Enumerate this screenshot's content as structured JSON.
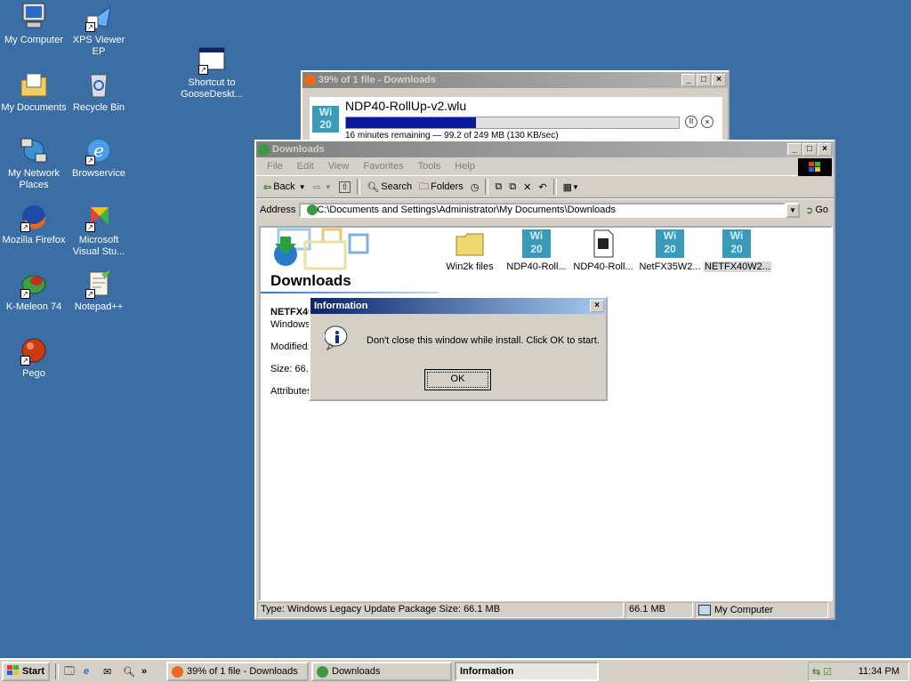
{
  "desktop": {
    "icons": [
      {
        "label": "My Computer"
      },
      {
        "label": "XPS Viewer EP"
      },
      {
        "label": "My Documents"
      },
      {
        "label": "Recycle Bin"
      },
      {
        "label": "My Network Places"
      },
      {
        "label": "Browservice"
      },
      {
        "label": "Mozilla Firefox"
      },
      {
        "label": "Microsoft Visual Stu..."
      },
      {
        "label": "K-Meleon 74"
      },
      {
        "label": "Notepad++"
      },
      {
        "label": "Pego"
      },
      {
        "label": "Shortcut to GooseDeskt..."
      }
    ]
  },
  "download_window": {
    "title": "39% of 1 file - Downloads",
    "filename": "NDP40-RollUp-v2.wlu",
    "progress": 0.39,
    "status": "16 minutes remaining — 99.2 of 249 MB (130 KB/sec)"
  },
  "explorer": {
    "title": "Downloads",
    "menu": [
      "File",
      "Edit",
      "View",
      "Favorites",
      "Tools",
      "Help"
    ],
    "toolbar": {
      "back": "Back",
      "search": "Search",
      "folders": "Folders"
    },
    "address_label": "Address",
    "address_value": "C:\\Documents and Settings\\Administrator\\My Documents\\Downloads",
    "go_label": "Go",
    "panel_title": "Downloads",
    "details": {
      "name": "NETFX40",
      "type": "Windows",
      "modified": "Modified:",
      "size": "Size: 66.1",
      "attributes": "Attributes:"
    },
    "files": [
      {
        "name": "Win2k files",
        "kind": "folder"
      },
      {
        "name": "NDP40-Roll...",
        "kind": "win2k"
      },
      {
        "name": "NDP40-Roll...",
        "kind": "doc"
      },
      {
        "name": "NetFX35W2...",
        "kind": "win2k"
      },
      {
        "name": "NETFX40W2...",
        "kind": "win2k"
      }
    ],
    "status": {
      "info": "Type: Windows Legacy Update Package Size: 66.1 MB",
      "size": "66.1 MB",
      "zone": "My Computer"
    }
  },
  "dialog": {
    "title": "Information",
    "message": "Don't close this window while install. Click OK to start.",
    "ok_label": "OK"
  },
  "taskbar": {
    "start_label": "Start",
    "tasks": [
      {
        "label": "39% of 1 file - Downloads"
      },
      {
        "label": "Downloads"
      },
      {
        "label": "Information"
      }
    ],
    "clock": "11:34 PM"
  }
}
